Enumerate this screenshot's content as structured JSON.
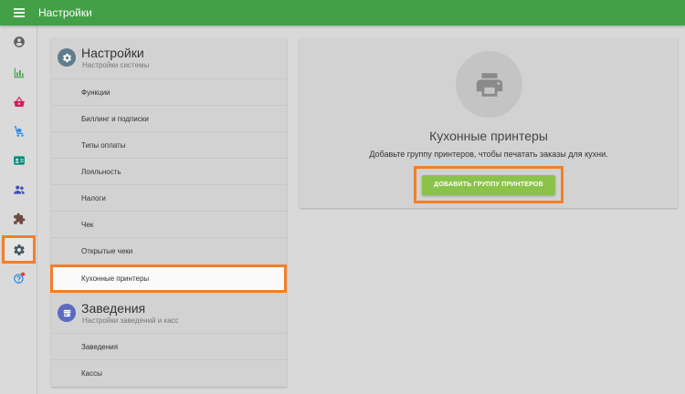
{
  "topbar": {
    "title": "Настройки",
    "menu_icon": "hamburger-icon"
  },
  "sidebar": {
    "items": [
      {
        "name": "account",
        "icon": "account-circle-icon"
      },
      {
        "name": "reports",
        "icon": "bar-chart-icon"
      },
      {
        "name": "items",
        "icon": "basket-icon"
      },
      {
        "name": "inventory",
        "icon": "cart-icon"
      },
      {
        "name": "employees",
        "icon": "id-card-icon"
      },
      {
        "name": "customers",
        "icon": "people-icon"
      },
      {
        "name": "integrations",
        "icon": "puzzle-icon"
      },
      {
        "name": "settings",
        "icon": "gear-icon",
        "active": true
      },
      {
        "name": "help",
        "icon": "help-icon"
      }
    ],
    "colors": {
      "active_border": "#f07f2b"
    }
  },
  "settings": {
    "section1": {
      "title": "Настройки",
      "subtitle": "Настройки системы",
      "items": [
        "Функции",
        "Биллинг и подписки",
        "Типы оплаты",
        "Лояльность",
        "Налоги",
        "Чек",
        "Открытые чеки",
        "Кухонные принтеры"
      ],
      "selected": "Кухонные принтеры"
    },
    "section2": {
      "title": "Заведения",
      "subtitle": "Настройки заведений и касс",
      "items": [
        "Заведения",
        "Кассы"
      ]
    }
  },
  "content": {
    "icon": "printer-icon",
    "title": "Кухонные принтеры",
    "description": "Добавьте группу принтеров, чтобы печатать заказы для кухни.",
    "button_label": "ДОБАВИТЬ ГРУППУ ПРИНТЕРОВ"
  },
  "colors": {
    "topbar": "#43a047",
    "button": "#8bc34a",
    "highlight": "#f07f2b"
  }
}
